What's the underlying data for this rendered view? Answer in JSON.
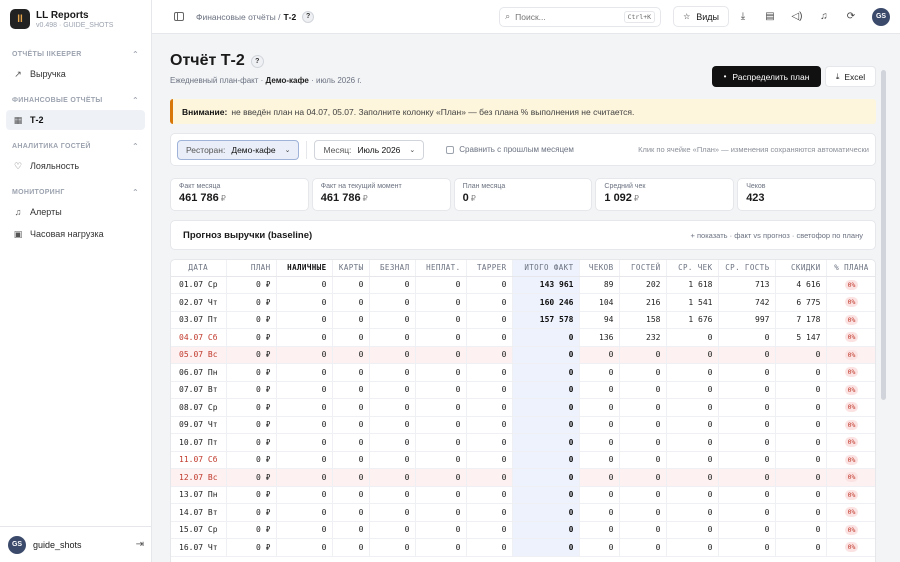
{
  "brand": {
    "title": "LL Reports",
    "subtitle": "v0.498 · GUIDE_SHOTS",
    "logo_letter": "ll"
  },
  "sidebar": {
    "sections": [
      {
        "title": "ОТЧЁТЫ IIKEEPER",
        "items": [
          {
            "label": "Выручка",
            "icon": "trend-icon",
            "active": false
          }
        ]
      },
      {
        "title": "ФИНАНСОВЫЕ ОТЧЁТЫ",
        "items": [
          {
            "label": "Т-2",
            "icon": "table-icon",
            "active": true
          }
        ]
      },
      {
        "title": "АНАЛИТИКА ГОСТЕЙ",
        "items": [
          {
            "label": "Лояльность",
            "icon": "heart-icon",
            "active": false
          }
        ]
      },
      {
        "title": "МОНИТОРИНГ",
        "items": [
          {
            "label": "Алерты",
            "icon": "bell-icon",
            "active": false
          },
          {
            "label": "Часовая нагрузка",
            "icon": "calendar-icon",
            "active": false
          }
        ]
      }
    ],
    "user": {
      "initials": "GS",
      "name": "guide_shots"
    }
  },
  "topbar": {
    "breadcrumb_parent": "Финансовые отчёты /",
    "breadcrumb_current": "Т-2",
    "help": "?",
    "search_placeholder": "Поиск...",
    "search_kbd": "Ctrl+K",
    "views_label": "Виды",
    "avatar": "GS"
  },
  "page": {
    "title": "Отчёт Т-2",
    "help": "?",
    "sub_prefix": "Ежедневный план-факт ·",
    "sub_venue": "Демо-кафе",
    "sub_suffix": "· июль 2026 г.",
    "distribute_label": "Распределить план",
    "excel_label": "Excel"
  },
  "alert": {
    "title": "Внимание:",
    "text": "не введён план на 04.07, 05.07. Заполните колонку «План» — без плана % выполнения не считается.",
    "accent": "#d97706"
  },
  "filters": {
    "restaurant_label": "Ресторан:",
    "restaurant_value": "Демо-кафе",
    "month_label": "Месяц:",
    "month_value": "Июль 2026",
    "compare_label": "Сравнить с прошлым месяцем",
    "hint": "Клик по ячейке «План» — изменения сохраняются автоматически"
  },
  "cards": [
    {
      "label": "Факт месяца",
      "value": "461 786",
      "currency": "₽"
    },
    {
      "label": "Факт на текущий момент",
      "value": "461 786",
      "currency": "₽"
    },
    {
      "label": "План месяца",
      "value": "0",
      "currency": "₽"
    },
    {
      "label": "Средний чек",
      "value": "1 092",
      "currency": "₽"
    },
    {
      "label": "Чеков",
      "value": "423",
      "currency": ""
    }
  ],
  "forecast": {
    "title": "Прогноз выручки (baseline)",
    "hint": "+ показать · факт vs прогноз · светофор по плану"
  },
  "table": {
    "headers": [
      "ДАТА",
      "ПЛАН",
      "НАЛИЧНЫЕ",
      "КАРТЫ",
      "БЕЗНАЛ",
      "НЕПЛАТ.",
      "TAPPER",
      "ИТОГО ФАКТ",
      "ЧЕКОВ",
      "ГОСТЕЙ",
      "СР. ЧЕК",
      "СР. ГОСТЬ",
      "СКИДКИ",
      "% ПЛАНА"
    ],
    "rows": [
      {
        "date": "01.07 Ср",
        "kind": "",
        "cells": [
          "0 ₽",
          "0",
          "0",
          "0",
          "0",
          "0",
          "143 961",
          "89",
          "202",
          "1 618",
          "713",
          "4 616",
          "0%"
        ]
      },
      {
        "date": "02.07 Чт",
        "kind": "",
        "cells": [
          "0 ₽",
          "0",
          "0",
          "0",
          "0",
          "0",
          "160 246",
          "104",
          "216",
          "1 541",
          "742",
          "6 775",
          "0%"
        ]
      },
      {
        "date": "03.07 Пт",
        "kind": "",
        "cells": [
          "0 ₽",
          "0",
          "0",
          "0",
          "0",
          "0",
          "157 578",
          "94",
          "158",
          "1 676",
          "997",
          "7 178",
          "0%"
        ]
      },
      {
        "date": "04.07 Сб",
        "kind": "weekend",
        "cells": [
          "0 ₽",
          "0",
          "0",
          "0",
          "0",
          "0",
          "0",
          "136",
          "232",
          "0",
          "0",
          "5 147",
          "0%"
        ]
      },
      {
        "date": "05.07 Вс",
        "kind": "sunday",
        "cells": [
          "0 ₽",
          "0",
          "0",
          "0",
          "0",
          "0",
          "0",
          "0",
          "0",
          "0",
          "0",
          "0",
          "0%"
        ]
      },
      {
        "date": "06.07 Пн",
        "kind": "",
        "cells": [
          "0 ₽",
          "0",
          "0",
          "0",
          "0",
          "0",
          "0",
          "0",
          "0",
          "0",
          "0",
          "0",
          "0%"
        ]
      },
      {
        "date": "07.07 Вт",
        "kind": "",
        "cells": [
          "0 ₽",
          "0",
          "0",
          "0",
          "0",
          "0",
          "0",
          "0",
          "0",
          "0",
          "0",
          "0",
          "0%"
        ]
      },
      {
        "date": "08.07 Ср",
        "kind": "",
        "cells": [
          "0 ₽",
          "0",
          "0",
          "0",
          "0",
          "0",
          "0",
          "0",
          "0",
          "0",
          "0",
          "0",
          "0%"
        ]
      },
      {
        "date": "09.07 Чт",
        "kind": "",
        "cells": [
          "0 ₽",
          "0",
          "0",
          "0",
          "0",
          "0",
          "0",
          "0",
          "0",
          "0",
          "0",
          "0",
          "0%"
        ]
      },
      {
        "date": "10.07 Пт",
        "kind": "",
        "cells": [
          "0 ₽",
          "0",
          "0",
          "0",
          "0",
          "0",
          "0",
          "0",
          "0",
          "0",
          "0",
          "0",
          "0%"
        ]
      },
      {
        "date": "11.07 Сб",
        "kind": "weekend",
        "cells": [
          "0 ₽",
          "0",
          "0",
          "0",
          "0",
          "0",
          "0",
          "0",
          "0",
          "0",
          "0",
          "0",
          "0%"
        ]
      },
      {
        "date": "12.07 Вс",
        "kind": "sunday",
        "cells": [
          "0 ₽",
          "0",
          "0",
          "0",
          "0",
          "0",
          "0",
          "0",
          "0",
          "0",
          "0",
          "0",
          "0%"
        ]
      },
      {
        "date": "13.07 Пн",
        "kind": "",
        "cells": [
          "0 ₽",
          "0",
          "0",
          "0",
          "0",
          "0",
          "0",
          "0",
          "0",
          "0",
          "0",
          "0",
          "0%"
        ]
      },
      {
        "date": "14.07 Вт",
        "kind": "",
        "cells": [
          "0 ₽",
          "0",
          "0",
          "0",
          "0",
          "0",
          "0",
          "0",
          "0",
          "0",
          "0",
          "0",
          "0%"
        ]
      },
      {
        "date": "15.07 Ср",
        "kind": "",
        "cells": [
          "0 ₽",
          "0",
          "0",
          "0",
          "0",
          "0",
          "0",
          "0",
          "0",
          "0",
          "0",
          "0",
          "0%"
        ]
      },
      {
        "date": "16.07 Чт",
        "kind": "",
        "cells": [
          "0 ₽",
          "0",
          "0",
          "0",
          "0",
          "0",
          "0",
          "0",
          "0",
          "0",
          "0",
          "0",
          "0%"
        ]
      }
    ]
  }
}
